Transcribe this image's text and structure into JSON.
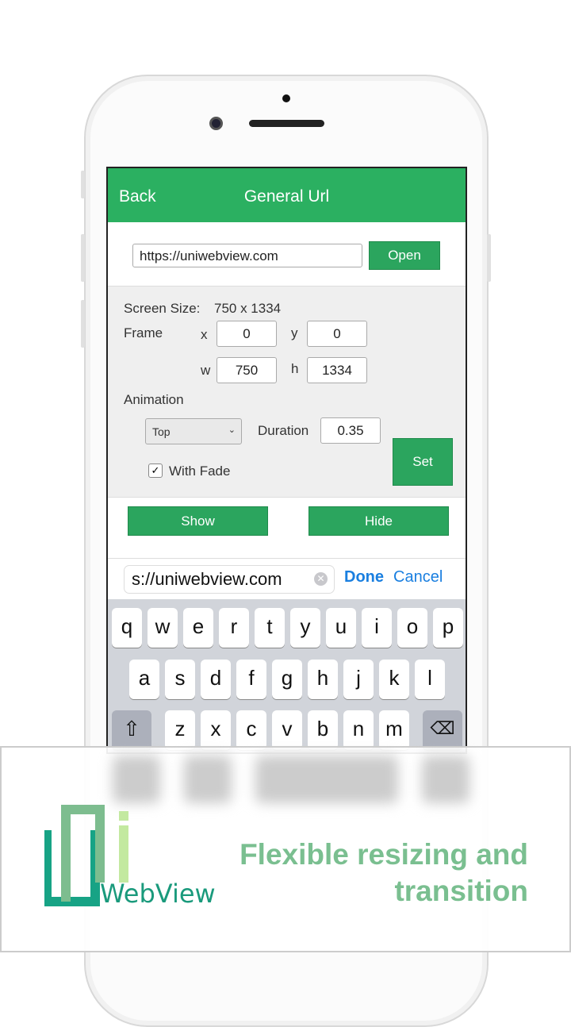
{
  "nav": {
    "back": "Back",
    "title": "General Url"
  },
  "url": {
    "value": "https://uniwebview.com",
    "open": "Open"
  },
  "panel": {
    "screen_size_label": "Screen Size:",
    "screen_size": "750 x 1334",
    "frame_label": "Frame",
    "x_label": "x",
    "x": "0",
    "y_label": "y",
    "y": "0",
    "w_label": "w",
    "w": "750",
    "h_label": "h",
    "h": "1334",
    "animation_label": "Animation",
    "animation_select": "Top",
    "duration_label": "Duration",
    "duration": "0.35",
    "with_fade_label": "With Fade",
    "with_fade_checked": true,
    "set": "Set"
  },
  "actions": {
    "show": "Show",
    "hide": "Hide"
  },
  "accessory": {
    "input_value": "s://uniwebview.com",
    "done": "Done",
    "cancel": "Cancel"
  },
  "keyboard": {
    "row1": [
      "q",
      "w",
      "e",
      "r",
      "t",
      "y",
      "u",
      "i",
      "o",
      "p"
    ],
    "row2": [
      "a",
      "s",
      "d",
      "f",
      "g",
      "h",
      "j",
      "k",
      "l"
    ],
    "row3": [
      "z",
      "x",
      "c",
      "v",
      "b",
      "n",
      "m"
    ]
  },
  "banner": {
    "logo_text": "WebView",
    "tagline_line1": "Flexible resizing and",
    "tagline_line2": "transition"
  },
  "colors": {
    "accent": "#2bb061",
    "link": "#1a7fe0",
    "tagline": "#7abf90"
  }
}
